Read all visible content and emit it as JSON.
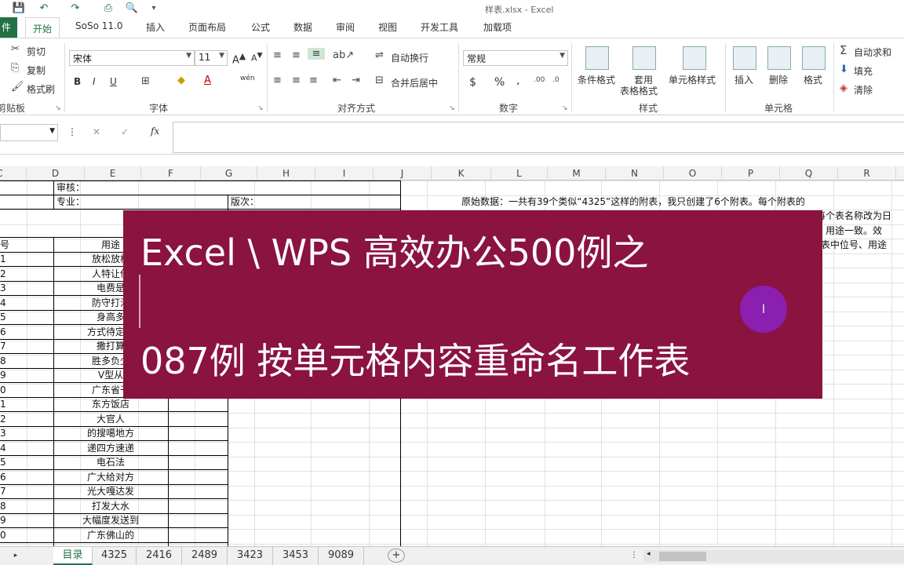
{
  "window": {
    "title": "样表.xlsx - Excel"
  },
  "ribbon_tabs": [
    "件",
    "开始",
    "SoSo 11.0",
    "插入",
    "页面布局",
    "公式",
    "数据",
    "审阅",
    "视图",
    "开发工具",
    "加载项"
  ],
  "clipboard": {
    "cut": "剪切",
    "copy": "复制",
    "format_painter": "格式刷",
    "label": "剪贴板"
  },
  "font": {
    "name": "宋体",
    "size": "11",
    "bold": "B",
    "italic": "I",
    "underline": "U",
    "wen": "wén",
    "label": "字体"
  },
  "alignment": {
    "wrap": "自动换行",
    "merge": "合并后居中",
    "label": "对齐方式"
  },
  "number": {
    "format": "常规",
    "label": "数字",
    "currency": "$",
    "percent": "%",
    "comma": ","
  },
  "styles": {
    "conditional": "条件格式",
    "table_line1": "套用",
    "table_line2": "表格格式",
    "cell_styles": "单元格样式",
    "label": "样式"
  },
  "cells": {
    "insert": "插入",
    "delete": "删除",
    "format": "格式",
    "label": "单元格"
  },
  "editing": {
    "autosum": "自动求和",
    "fill": "填充",
    "clear": "清除"
  },
  "formula_bar": {
    "fx": "fx",
    "cancel": "✕",
    "enter": "✓"
  },
  "columns": [
    "C",
    "D",
    "E",
    "F",
    "G",
    "H",
    "I",
    "J",
    "K",
    "L",
    "M",
    "N",
    "O",
    "P",
    "Q",
    "R"
  ],
  "sheet": {
    "review_label": "审核：",
    "major_label": "专业：",
    "edition_label": "版次：",
    "col_num_header": "号",
    "col_use_header": "用途",
    "row_numbers": [
      "1",
      "2",
      "3",
      "4",
      "5",
      "6",
      "7",
      "8",
      "9",
      "0",
      "1",
      "2",
      "3",
      "4",
      "5",
      "6",
      "7",
      "8",
      "9",
      "0"
    ],
    "uses": [
      "放松放松",
      "人特让他",
      "电费是",
      "防守打池",
      "身高多",
      "方式待定发",
      "撒打算",
      "胜多负少",
      "V型从",
      "广东省干",
      "东方饭店",
      "大官人",
      "的搜噶地方",
      "递四方速递",
      "电石法",
      "广大给对方",
      "光大嘎达发",
      "打发大水",
      "大幅度发送到",
      "广东佛山的"
    ],
    "note_line1": "原始数据：一共有39个类似“4325”这样的附表，我只创建了6个附表。每个附表的",
    "note_line2": "每个表名称改为日",
    "note_line3": "、用途一致。效",
    "note_line4": "表中位号、用途"
  },
  "banner": {
    "line1": "Excel \\ WPS 高效办公500例之",
    "line2": "087例 按单元格内容重命名工作表",
    "cursor_glyph": "I"
  },
  "sheet_tabs": [
    "目录",
    "4325",
    "2416",
    "2489",
    "3423",
    "3453",
    "9089"
  ],
  "add_sheet": "+"
}
